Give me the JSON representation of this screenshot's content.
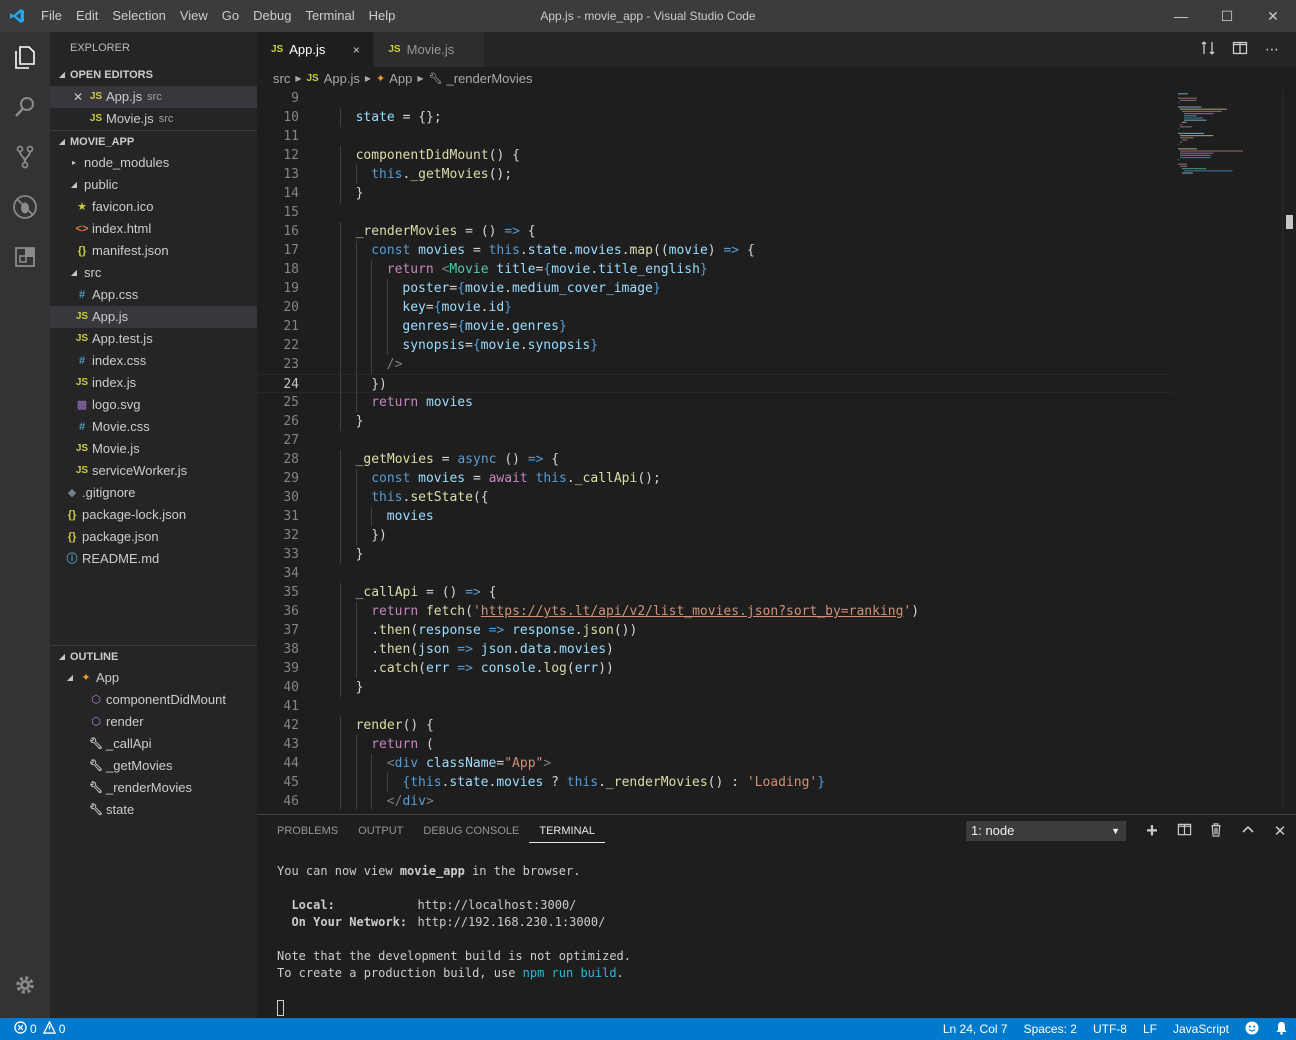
{
  "window": {
    "title": "App.js - movie_app - Visual Studio Code",
    "menu": [
      "File",
      "Edit",
      "Selection",
      "View",
      "Go",
      "Debug",
      "Terminal",
      "Help"
    ]
  },
  "sidebar": {
    "title": "EXPLORER",
    "open_editors": {
      "header": "OPEN EDITORS",
      "items": [
        {
          "name": "App.js",
          "desc": "src"
        },
        {
          "name": "Movie.js",
          "desc": "src"
        }
      ]
    },
    "project": {
      "header": "MOVIE_APP",
      "items": [
        {
          "name": "node_modules",
          "icon": "folder-collapsed"
        },
        {
          "name": "public",
          "icon": "folder-expanded"
        },
        {
          "name": "favicon.ico",
          "icon": "star-icon"
        },
        {
          "name": "index.html",
          "icon": "html-icon"
        },
        {
          "name": "manifest.json",
          "icon": "json-icon"
        },
        {
          "name": "src",
          "icon": "folder-expanded"
        },
        {
          "name": "App.css",
          "icon": "css-icon"
        },
        {
          "name": "App.js",
          "icon": "js-icon"
        },
        {
          "name": "App.test.js",
          "icon": "js-icon"
        },
        {
          "name": "index.css",
          "icon": "css-icon"
        },
        {
          "name": "index.js",
          "icon": "js-icon"
        },
        {
          "name": "logo.svg",
          "icon": "svg-icon"
        },
        {
          "name": "Movie.css",
          "icon": "css-icon"
        },
        {
          "name": "Movie.js",
          "icon": "js-icon"
        },
        {
          "name": "serviceWorker.js",
          "icon": "js-icon"
        },
        {
          "name": ".gitignore",
          "icon": "git-icon"
        },
        {
          "name": "package-lock.json",
          "icon": "json-icon"
        },
        {
          "name": "package.json",
          "icon": "json-icon"
        },
        {
          "name": "README.md",
          "icon": "info-icon"
        }
      ]
    },
    "outline": {
      "header": "OUTLINE",
      "root": "App",
      "items": [
        {
          "name": "componentDidMount",
          "icon": "method-icon"
        },
        {
          "name": "render",
          "icon": "method-icon"
        },
        {
          "name": "_callApi",
          "icon": "wrench-icon"
        },
        {
          "name": "_getMovies",
          "icon": "wrench-icon"
        },
        {
          "name": "_renderMovies",
          "icon": "wrench-icon"
        },
        {
          "name": "state",
          "icon": "wrench-icon"
        }
      ]
    }
  },
  "tabs": [
    {
      "label": "App.js",
      "badge": "JS",
      "close": "×"
    },
    {
      "label": "Movie.js",
      "badge": "JS"
    }
  ],
  "breadcrumb": {
    "folder": "src",
    "file": "App.js",
    "class": "App",
    "member": "_renderMovies"
  },
  "editor": {
    "current_line": "24",
    "lines": [
      {
        "n": "9",
        "i": 0,
        "t": ""
      },
      {
        "n": "10",
        "i": 1,
        "t": "<span class='v'>state</span> <span class='o'>=</span> <span class='o'>{};</span>"
      },
      {
        "n": "11",
        "i": 0,
        "t": ""
      },
      {
        "n": "12",
        "i": 1,
        "t": "<span class='f'>componentDidMount</span><span class='o'>() {</span>"
      },
      {
        "n": "13",
        "i": 2,
        "t": "<span class='k'>this</span><span class='o'>.</span><span class='f'>_getMovies</span><span class='o'>();</span>"
      },
      {
        "n": "14",
        "i": 1,
        "t": "<span class='o'>}</span>"
      },
      {
        "n": "15",
        "i": 0,
        "t": ""
      },
      {
        "n": "16",
        "i": 1,
        "t": "<span class='f'>_renderMovies</span> <span class='o'>=</span> <span class='o'>()</span> <span class='k'>=&gt;</span> <span class='o'>{</span>"
      },
      {
        "n": "17",
        "i": 2,
        "t": "<span class='k'>const</span> <span class='v'>movies</span> <span class='o'>=</span> <span class='k'>this</span><span class='o'>.</span><span class='v'>state</span><span class='o'>.</span><span class='v'>movies</span><span class='o'>.</span><span class='f'>map</span><span class='o'>((</span><span class='v'>movie</span><span class='o'>)</span> <span class='k'>=&gt;</span> <span class='o'>{</span>"
      },
      {
        "n": "18",
        "i": 3,
        "t": "<span class='c'>return</span> <span class='pun'>&lt;</span><span class='t'>Movie</span> <span class='v'>title</span><span class='o'>=</span><span class='br'>{</span><span class='v'>movie</span><span class='o'>.</span><span class='v'>title_english</span><span class='br'>}</span>"
      },
      {
        "n": "19",
        "i": 4,
        "t": "<span class='v'>poster</span><span class='o'>=</span><span class='br'>{</span><span class='v'>movie</span><span class='o'>.</span><span class='v'>medium_cover_image</span><span class='br'>}</span>"
      },
      {
        "n": "20",
        "i": 4,
        "t": "<span class='v'>key</span><span class='o'>=</span><span class='br'>{</span><span class='v'>movie</span><span class='o'>.</span><span class='v'>id</span><span class='br'>}</span>"
      },
      {
        "n": "21",
        "i": 4,
        "t": "<span class='v'>genres</span><span class='o'>=</span><span class='br'>{</span><span class='v'>movie</span><span class='o'>.</span><span class='v'>genres</span><span class='br'>}</span>"
      },
      {
        "n": "22",
        "i": 4,
        "t": "<span class='v'>synopsis</span><span class='o'>=</span><span class='br'>{</span><span class='v'>movie</span><span class='o'>.</span><span class='v'>synopsis</span><span class='br'>}</span>"
      },
      {
        "n": "23",
        "i": 3,
        "t": "<span class='pun'>/&gt;</span>"
      },
      {
        "n": "24",
        "i": 2,
        "t": "<span class='o'>})</span>"
      },
      {
        "n": "25",
        "i": 2,
        "t": "<span class='c'>return</span> <span class='v'>movies</span>"
      },
      {
        "n": "26",
        "i": 1,
        "t": "<span class='o'>}</span>"
      },
      {
        "n": "27",
        "i": 0,
        "t": ""
      },
      {
        "n": "28",
        "i": 1,
        "t": "<span class='f'>_getMovies</span> <span class='o'>=</span> <span class='k'>async</span> <span class='o'>()</span> <span class='k'>=&gt;</span> <span class='o'>{</span>"
      },
      {
        "n": "29",
        "i": 2,
        "t": "<span class='k'>const</span> <span class='v'>movies</span> <span class='o'>=</span> <span class='c'>await</span> <span class='k'>this</span><span class='o'>.</span><span class='f'>_callApi</span><span class='o'>();</span>"
      },
      {
        "n": "30",
        "i": 2,
        "t": "<span class='k'>this</span><span class='o'>.</span><span class='f'>setState</span><span class='o'>({</span>"
      },
      {
        "n": "31",
        "i": 3,
        "t": "<span class='v'>movies</span>"
      },
      {
        "n": "32",
        "i": 2,
        "t": "<span class='o'>})</span>"
      },
      {
        "n": "33",
        "i": 1,
        "t": "<span class='o'>}</span>"
      },
      {
        "n": "34",
        "i": 0,
        "t": ""
      },
      {
        "n": "35",
        "i": 1,
        "t": "<span class='f'>_callApi</span> <span class='o'>=</span> <span class='o'>()</span> <span class='k'>=&gt;</span> <span class='o'>{</span>"
      },
      {
        "n": "36",
        "i": 2,
        "t": "<span class='c'>return</span> <span class='f'>fetch</span><span class='o'>(</span><span class='s'>'<span class='u'>https://yts.lt/api/v2/list_movies.json?sort_by=ranking</span>'</span><span class='o'>)</span>"
      },
      {
        "n": "37",
        "i": 2,
        "t": "<span class='o'>.</span><span class='f'>then</span><span class='o'>(</span><span class='v'>response</span> <span class='k'>=&gt;</span> <span class='v'>response</span><span class='o'>.</span><span class='f'>json</span><span class='o'>())</span>"
      },
      {
        "n": "38",
        "i": 2,
        "t": "<span class='o'>.</span><span class='f'>then</span><span class='o'>(</span><span class='v'>json</span> <span class='k'>=&gt;</span> <span class='v'>json</span><span class='o'>.</span><span class='v'>data</span><span class='o'>.</span><span class='v'>movies</span><span class='o'>)</span>"
      },
      {
        "n": "39",
        "i": 2,
        "t": "<span class='o'>.</span><span class='f'>catch</span><span class='o'>(</span><span class='v'>err</span> <span class='k'>=&gt;</span> <span class='v'>console</span><span class='o'>.</span><span class='f'>log</span><span class='o'>(</span><span class='v'>err</span><span class='o'>))</span>"
      },
      {
        "n": "40",
        "i": 1,
        "t": "<span class='o'>}</span>"
      },
      {
        "n": "41",
        "i": 0,
        "t": ""
      },
      {
        "n": "42",
        "i": 1,
        "t": "<span class='f'>render</span><span class='o'>() {</span>"
      },
      {
        "n": "43",
        "i": 2,
        "t": "<span class='c'>return</span> <span class='o'>(</span>"
      },
      {
        "n": "44",
        "i": 3,
        "t": "<span class='pun'>&lt;</span><span class='k'>div</span> <span class='v'>className</span><span class='o'>=</span><span class='s'>\"App\"</span><span class='pun'>&gt;</span>"
      },
      {
        "n": "45",
        "i": 4,
        "t": "<span class='br'>{</span><span class='k'>this</span><span class='o'>.</span><span class='v'>state</span><span class='o'>.</span><span class='v'>movies</span> <span class='o'>?</span> <span class='k'>this</span><span class='o'>.</span><span class='f'>_renderMovies</span><span class='o'>()</span> <span class='o'>:</span> <span class='s'>'Loading'</span><span class='br'>}</span>"
      },
      {
        "n": "46",
        "i": 3,
        "t": "<span class='pun'>&lt;/</span><span class='k'>div</span><span class='pun'>&gt;</span>"
      }
    ]
  },
  "panel": {
    "tabs": [
      "PROBLEMS",
      "OUTPUT",
      "DEBUG CONSOLE",
      "TERMINAL"
    ],
    "active_tab": "TERMINAL",
    "terminal_select": "1: node",
    "terminal": {
      "l1_pre": "You can now view ",
      "l1_app": "movie_app",
      "l1_post": " in the browser.",
      "local_label": "Local:",
      "local_url": "http://localhost:3000/",
      "network_label": "On Your Network:",
      "network_url": "http://192.168.230.1:3000/",
      "note": "Note that the development build is not optimized.",
      "create_pre": "To create a production build, use ",
      "create_cmd": "npm run build",
      "create_post": "."
    }
  },
  "statusbar": {
    "errors": "0",
    "warnings": "0",
    "position": "Ln 24, Col 7",
    "spaces": "Spaces: 2",
    "encoding": "UTF-8",
    "eol": "LF",
    "language": "JavaScript"
  },
  "colors": {
    "statusbar": "#007acc",
    "activitybar": "#333333",
    "sidebar": "#252526",
    "editor": "#1e1e1e"
  }
}
